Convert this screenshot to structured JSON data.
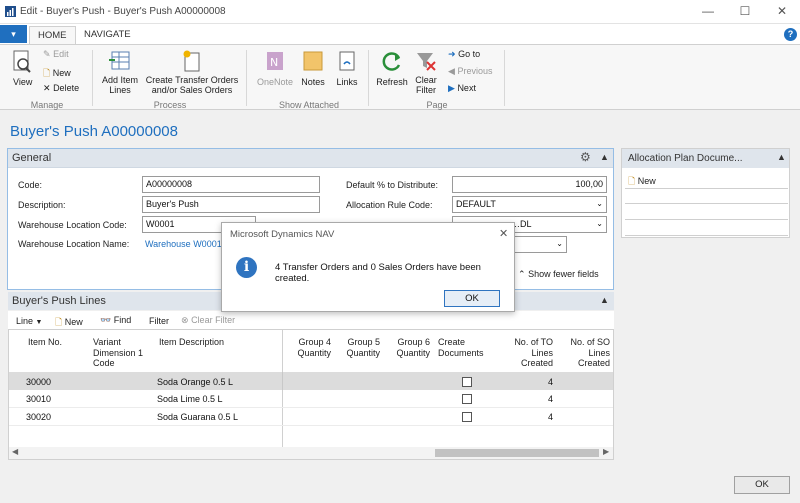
{
  "window": {
    "title": "Edit - Buyer's Push - Buyer's Push A00000008",
    "minimize": "—",
    "maximize": "☐",
    "close": "✕"
  },
  "ribbon": {
    "file_label": "▾",
    "tabs": [
      "HOME",
      "NAVIGATE"
    ],
    "help": "?",
    "manage": {
      "label": "Manage",
      "view": "View",
      "edit": "Edit",
      "new": "New",
      "delete": "Delete"
    },
    "process": {
      "label": "Process",
      "add_item_lines_1": "Add Item",
      "add_item_lines_2": "Lines",
      "create_orders_1": "Create Transfer Orders",
      "create_orders_2": "and/or Sales Orders"
    },
    "show_attached": {
      "label": "Show Attached",
      "onenote": "OneNote",
      "notes": "Notes",
      "links": "Links"
    },
    "page": {
      "label": "Page",
      "refresh": "Refresh",
      "clear_filter_1": "Clear",
      "clear_filter_2": "Filter",
      "go_to": "Go to",
      "previous": "Previous",
      "next": "Next"
    }
  },
  "page_title": "Buyer's Push A00000008",
  "general": {
    "title": "General",
    "code_label": "Code:",
    "code_value": "A00000008",
    "description_label": "Description:",
    "description_value": "Buyer's Push",
    "wh_code_label": "Warehouse Location Code:",
    "wh_code_value": "W0001",
    "wh_name_label": "Warehouse Location Name:",
    "wh_name_value": "Warehouse W0001",
    "default_pct_label": "Default % to Distribute:",
    "default_pct_value": "100,00",
    "alloc_rule_label": "Allocation Rule Code:",
    "alloc_rule_value": "DEFAULT",
    "hidden_field_value": "…DL",
    "show_fewer": "Show fewer fields"
  },
  "lines": {
    "title": "Buyer's Push Lines",
    "toolbar": {
      "line": "Line",
      "new": "New",
      "find": "Find",
      "filter": "Filter",
      "clear_filter": "Clear Filter"
    },
    "columns": {
      "item_no": "Item No.",
      "variant_1": "Variant",
      "variant_2": "Dimension 1",
      "variant_3": "Code",
      "item_desc": "Item Description",
      "g4_1": "Group 4",
      "g4_2": "Quantity",
      "g5_1": "Group 5",
      "g5_2": "Quantity",
      "g6_1": "Group 6",
      "g6_2": "Quantity",
      "create_1": "Create",
      "create_2": "Documents",
      "to_1": "No. of TO",
      "to_2": "Lines",
      "to_3": "Created",
      "so_1": "No. of SO",
      "so_2": "Lines",
      "so_3": "Created"
    },
    "rows": [
      {
        "item_no": "30000",
        "desc": "Soda Orange 0.5 L",
        "to_lines": "4"
      },
      {
        "item_no": "30010",
        "desc": "Soda Lime 0.5 L",
        "to_lines": "4"
      },
      {
        "item_no": "30020",
        "desc": "Soda Guarana 0.5 L",
        "to_lines": "4"
      }
    ]
  },
  "side_panel": {
    "title": "Allocation Plan Docume...",
    "new": "New"
  },
  "dialog": {
    "title": "Microsoft Dynamics NAV",
    "message": "4 Transfer Orders and 0 Sales Orders have been created.",
    "ok": "OK",
    "info_glyph": "i"
  },
  "footer": {
    "ok": "OK"
  },
  "colors": {
    "accent": "#1f6fbf",
    "header_bg": "#dfe5ec"
  }
}
